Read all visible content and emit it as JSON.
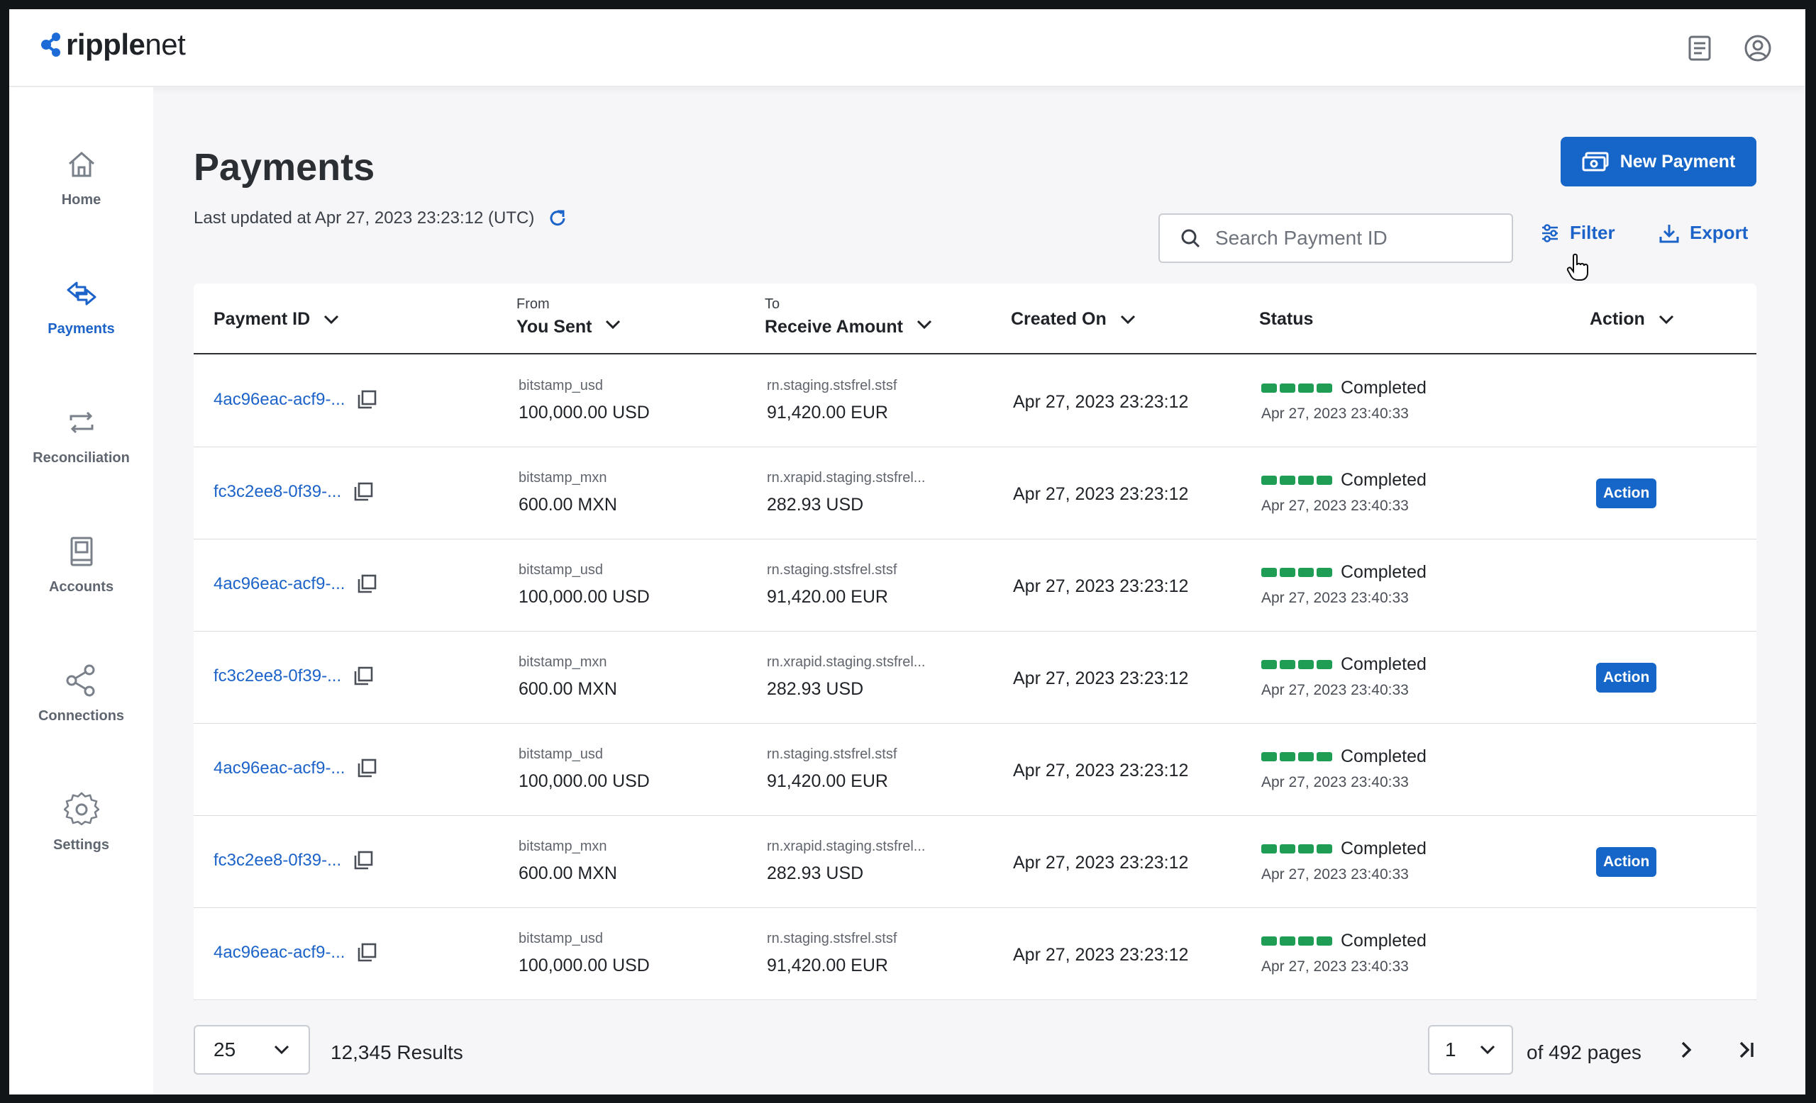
{
  "brand": {
    "name_bold": "ripple",
    "name_light": "net"
  },
  "header": {
    "docs_icon": "document-icon",
    "profile_icon": "user-circle-icon"
  },
  "sidebar": {
    "items": [
      {
        "label": "Home",
        "icon": "home-icon",
        "active": false
      },
      {
        "label": "Payments",
        "icon": "payments-arrows-icon",
        "active": true
      },
      {
        "label": "Reconciliation",
        "icon": "reconciliation-icon",
        "active": false
      },
      {
        "label": "Accounts",
        "icon": "book-icon",
        "active": false
      },
      {
        "label": "Connections",
        "icon": "share-nodes-icon",
        "active": false
      },
      {
        "label": "Settings",
        "icon": "gear-icon",
        "active": false
      }
    ]
  },
  "page": {
    "title": "Payments",
    "last_updated": "Last updated at Apr 27, 2023 23:23:12 (UTC)",
    "new_payment_label": "New Payment",
    "search_placeholder": "Search Payment ID",
    "filter_label": "Filter",
    "export_label": "Export"
  },
  "table": {
    "columns": {
      "payment_id": "Payment ID",
      "from_small": "From",
      "from_main": "You Sent",
      "to_small": "To",
      "to_main": "Receive Amount",
      "created": "Created On",
      "status": "Status",
      "action": "Action"
    },
    "rows": [
      {
        "id": "4ac96eac-acf9-...",
        "from_account": "bitstamp_usd",
        "sent": "100,000.00 USD",
        "to_account": "rn.staging.stsfrel.stsf",
        "received": "91,420.00 EUR",
        "created": "Apr 27, 2023 23:23:12",
        "status": "Completed",
        "status_date": "Apr 27, 2023 23:40:33",
        "action": ""
      },
      {
        "id": "fc3c2ee8-0f39-...",
        "from_account": "bitstamp_mxn",
        "sent": "600.00 MXN",
        "to_account": "rn.xrapid.staging.stsfrel...",
        "received": "282.93 USD",
        "created": "Apr 27, 2023 23:23:12",
        "status": "Completed",
        "status_date": "Apr 27, 2023 23:40:33",
        "action": "Action"
      },
      {
        "id": "4ac96eac-acf9-...",
        "from_account": "bitstamp_usd",
        "sent": "100,000.00 USD",
        "to_account": "rn.staging.stsfrel.stsf",
        "received": "91,420.00 EUR",
        "created": "Apr 27, 2023 23:23:12",
        "status": "Completed",
        "status_date": "Apr 27, 2023 23:40:33",
        "action": ""
      },
      {
        "id": "fc3c2ee8-0f39-...",
        "from_account": "bitstamp_mxn",
        "sent": "600.00 MXN",
        "to_account": "rn.xrapid.staging.stsfrel...",
        "received": "282.93 USD",
        "created": "Apr 27, 2023 23:23:12",
        "status": "Completed",
        "status_date": "Apr 27, 2023 23:40:33",
        "action": "Action"
      },
      {
        "id": "4ac96eac-acf9-...",
        "from_account": "bitstamp_usd",
        "sent": "100,000.00 USD",
        "to_account": "rn.staging.stsfrel.stsf",
        "received": "91,420.00 EUR",
        "created": "Apr 27, 2023 23:23:12",
        "status": "Completed",
        "status_date": "Apr 27, 2023 23:40:33",
        "action": ""
      },
      {
        "id": "fc3c2ee8-0f39-...",
        "from_account": "bitstamp_mxn",
        "sent": "600.00 MXN",
        "to_account": "rn.xrapid.staging.stsfrel...",
        "received": "282.93 USD",
        "created": "Apr 27, 2023 23:23:12",
        "status": "Completed",
        "status_date": "Apr 27, 2023 23:40:33",
        "action": "Action"
      },
      {
        "id": "4ac96eac-acf9-...",
        "from_account": "bitstamp_usd",
        "sent": "100,000.00 USD",
        "to_account": "rn.staging.stsfrel.stsf",
        "received": "91,420.00 EUR",
        "created": "Apr 27, 2023 23:23:12",
        "status": "Completed",
        "status_date": "Apr 27, 2023 23:40:33",
        "action": ""
      }
    ]
  },
  "footer": {
    "page_size": "25",
    "results": "12,345 Results",
    "current_page": "1",
    "of_pages": "of 492 pages"
  },
  "colors": {
    "accent": "#1665c8",
    "status_green": "#1f9d55"
  }
}
